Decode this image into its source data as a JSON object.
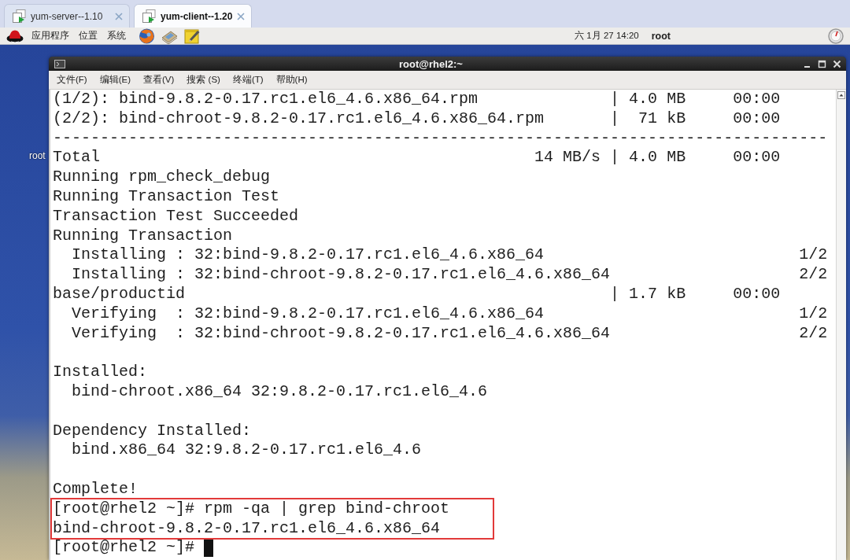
{
  "tabs": [
    {
      "label": "yum-server--1.10",
      "selected": false
    },
    {
      "label": "yum-client--1.20",
      "selected": true
    }
  ],
  "panel": {
    "menus": [
      "应用程序",
      "位置",
      "系统"
    ],
    "clock": "六 1月 27 14:20",
    "user": "root"
  },
  "desktop": {
    "icon_labels": [
      "root"
    ]
  },
  "terminal": {
    "title": "root@rhel2:~",
    "menu": [
      "文件(F)",
      "编辑(E)",
      "查看(V)",
      "搜索 (S)",
      "终端(T)",
      "帮助(H)"
    ],
    "cursor": true,
    "lines": [
      {
        "kind": "output",
        "text": "(1/2): bind-9.8.2-0.17.rc1.el6_4.6.x86_64.rpm              | 4.0 MB     00:00",
        "highlighted": false
      },
      {
        "kind": "output",
        "text": "(2/2): bind-chroot-9.8.2-0.17.rc1.el6_4.6.x86_64.rpm       |  71 kB     00:00",
        "highlighted": false
      },
      {
        "kind": "output",
        "text": "----------------------------------------------------------------------------------",
        "highlighted": false
      },
      {
        "kind": "output",
        "text": "Total                                              14 MB/s | 4.0 MB     00:00",
        "highlighted": false
      },
      {
        "kind": "output",
        "text": "Running rpm_check_debug",
        "highlighted": false
      },
      {
        "kind": "output",
        "text": "Running Transaction Test",
        "highlighted": false
      },
      {
        "kind": "output",
        "text": "Transaction Test Succeeded",
        "highlighted": false
      },
      {
        "kind": "output",
        "text": "Running Transaction",
        "highlighted": false
      },
      {
        "kind": "output",
        "text": "  Installing : 32:bind-9.8.2-0.17.rc1.el6_4.6.x86_64                           1/2",
        "highlighted": false
      },
      {
        "kind": "output",
        "text": "  Installing : 32:bind-chroot-9.8.2-0.17.rc1.el6_4.6.x86_64                    2/2",
        "highlighted": false
      },
      {
        "kind": "output",
        "text": "base/productid                                             | 1.7 kB     00:00",
        "highlighted": false
      },
      {
        "kind": "output",
        "text": "  Verifying  : 32:bind-9.8.2-0.17.rc1.el6_4.6.x86_64                           1/2",
        "highlighted": false
      },
      {
        "kind": "output",
        "text": "  Verifying  : 32:bind-chroot-9.8.2-0.17.rc1.el6_4.6.x86_64                    2/2",
        "highlighted": false
      },
      {
        "kind": "blank",
        "highlighted": false
      },
      {
        "kind": "output",
        "text": "Installed:",
        "highlighted": false
      },
      {
        "kind": "output",
        "text": "  bind-chroot.x86_64 32:9.8.2-0.17.rc1.el6_4.6",
        "highlighted": false
      },
      {
        "kind": "blank",
        "highlighted": false
      },
      {
        "kind": "output",
        "text": "Dependency Installed:",
        "highlighted": false
      },
      {
        "kind": "output",
        "text": "  bind.x86_64 32:9.8.2-0.17.rc1.el6_4.6",
        "highlighted": false
      },
      {
        "kind": "blank",
        "highlighted": false
      },
      {
        "kind": "output",
        "text": "Complete!",
        "highlighted": false
      },
      {
        "kind": "prompt",
        "text": "[root@rhel2 ~]# rpm -qa | grep bind-chroot",
        "highlighted": true
      },
      {
        "kind": "output",
        "text": "bind-chroot-9.8.2-0.17.rc1.el6_4.6.x86_64",
        "highlighted": true
      },
      {
        "kind": "prompt",
        "text": "[root@rhel2 ~]#",
        "highlighted": false
      }
    ]
  }
}
